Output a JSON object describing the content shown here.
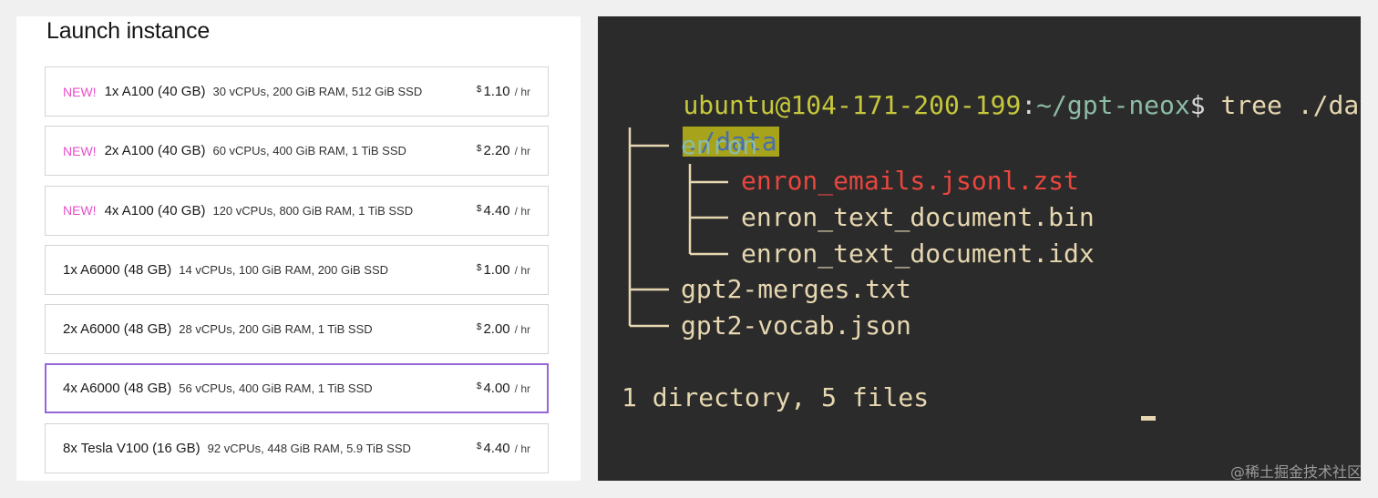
{
  "left": {
    "title": "Launch instance",
    "instances": [
      {
        "badge": "NEW!",
        "name": "1x A100 (40 GB)",
        "specs": "30 vCPUs, 200 GiB RAM, 512 GiB SSD",
        "currency": "$",
        "price": "1.10",
        "unit": "/ hr"
      },
      {
        "badge": "NEW!",
        "name": "2x A100 (40 GB)",
        "specs": "60 vCPUs, 400 GiB RAM, 1 TiB SSD",
        "currency": "$",
        "price": "2.20",
        "unit": "/ hr"
      },
      {
        "badge": "NEW!",
        "name": "4x A100 (40 GB)",
        "specs": "120 vCPUs, 800 GiB RAM, 1 TiB SSD",
        "currency": "$",
        "price": "4.40",
        "unit": "/ hr"
      },
      {
        "badge": "",
        "name": "1x A6000 (48 GB)",
        "specs": "14 vCPUs, 100 GiB RAM, 200 GiB SSD",
        "currency": "$",
        "price": "1.00",
        "unit": "/ hr"
      },
      {
        "badge": "",
        "name": "2x A6000 (48 GB)",
        "specs": "28 vCPUs, 200 GiB RAM, 1 TiB SSD",
        "currency": "$",
        "price": "2.00",
        "unit": "/ hr"
      },
      {
        "badge": "",
        "name": "4x A6000 (48 GB)",
        "specs": "56 vCPUs, 400 GiB RAM, 1 TiB SSD",
        "currency": "$",
        "price": "4.00",
        "unit": "/ hr",
        "selected": true
      },
      {
        "badge": "",
        "name": "8x Tesla V100 (16 GB)",
        "specs": "92 vCPUs, 448 GiB RAM, 5.9 TiB SSD",
        "currency": "$",
        "price": "4.40",
        "unit": "/ hr"
      }
    ],
    "colors": {
      "badge": "#e850c8",
      "selected_border": "#9466d6"
    }
  },
  "terminal": {
    "prompt_user": "ubuntu@104-171-200-199",
    "prompt_colon": ":",
    "prompt_path": "~/gpt-neox",
    "prompt_dollar": "$",
    "command": " tree ./data",
    "root": "./data",
    "dir_enron": "enron",
    "file_emails": "enron_emails.jsonl.zst",
    "file_bin": "enron_text_document.bin",
    "file_idx": "enron_text_document.idx",
    "file_merges": "gpt2-merges.txt",
    "file_vocab": "gpt2-vocab.json",
    "summary": "1 directory, 5 files",
    "colors": {
      "background": "#2b2b2b",
      "user": "#c6c83c",
      "path": "#8dbba4",
      "error_file": "#e8463e",
      "text": "#e6d7b0"
    }
  },
  "watermark": "@稀土掘金技术社区"
}
